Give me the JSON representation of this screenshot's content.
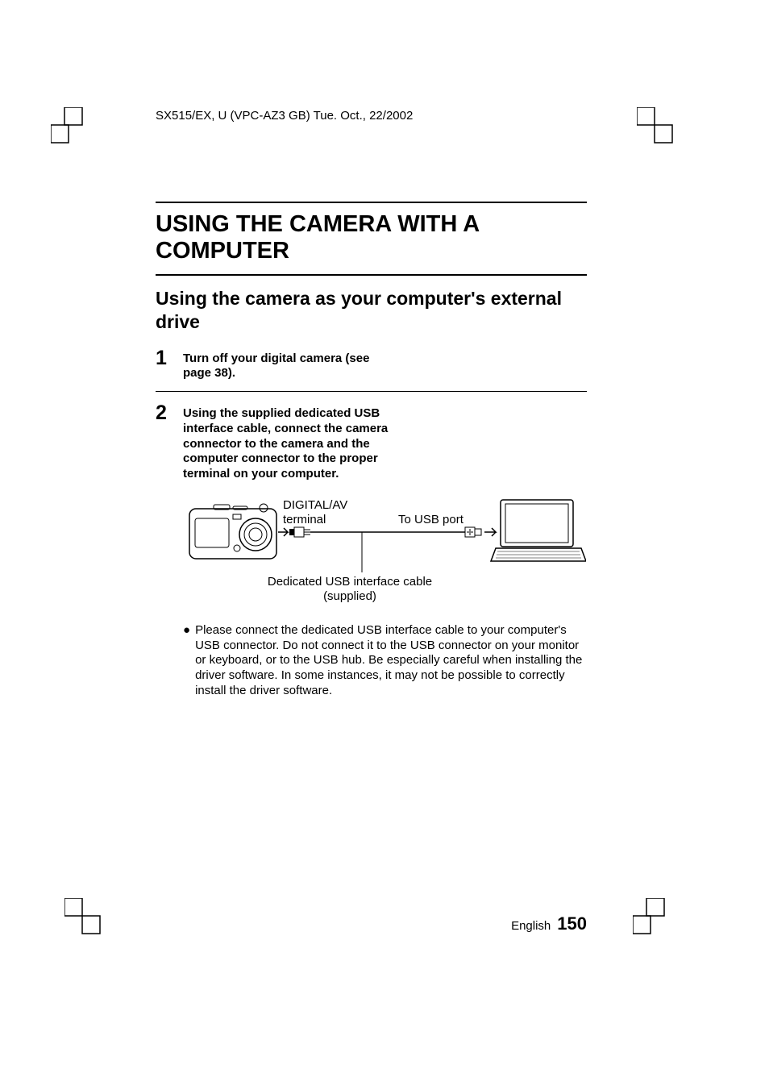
{
  "header": {
    "doc_info": "SX515/EX, U (VPC-AZ3 GB)    Tue. Oct., 22/2002"
  },
  "title": "USING THE CAMERA WITH A COMPUTER",
  "subtitle": "Using the camera as your computer's external drive",
  "steps": [
    {
      "number": "1",
      "text": "Turn off your digital camera (see page 38)."
    },
    {
      "number": "2",
      "text": "Using the supplied dedicated USB interface cable, connect the camera connector to the camera and the computer connector to the proper terminal on your computer."
    }
  ],
  "diagram": {
    "terminal_label_line1": "DIGITAL/AV",
    "terminal_label_line2": "terminal",
    "usb_port_label": "To USB port",
    "cable_label_line1": "Dedicated USB interface cable",
    "cable_label_line2": "(supplied)"
  },
  "bullet_text": "Please connect the dedicated USB interface cable to your computer's USB connector. Do not connect it to the USB connector on your monitor or keyboard, or to the USB hub. Be especially careful when installing the driver software. In some instances, it may not be possible to correctly install the driver software.",
  "footer": {
    "language": "English",
    "page_number": "150"
  }
}
